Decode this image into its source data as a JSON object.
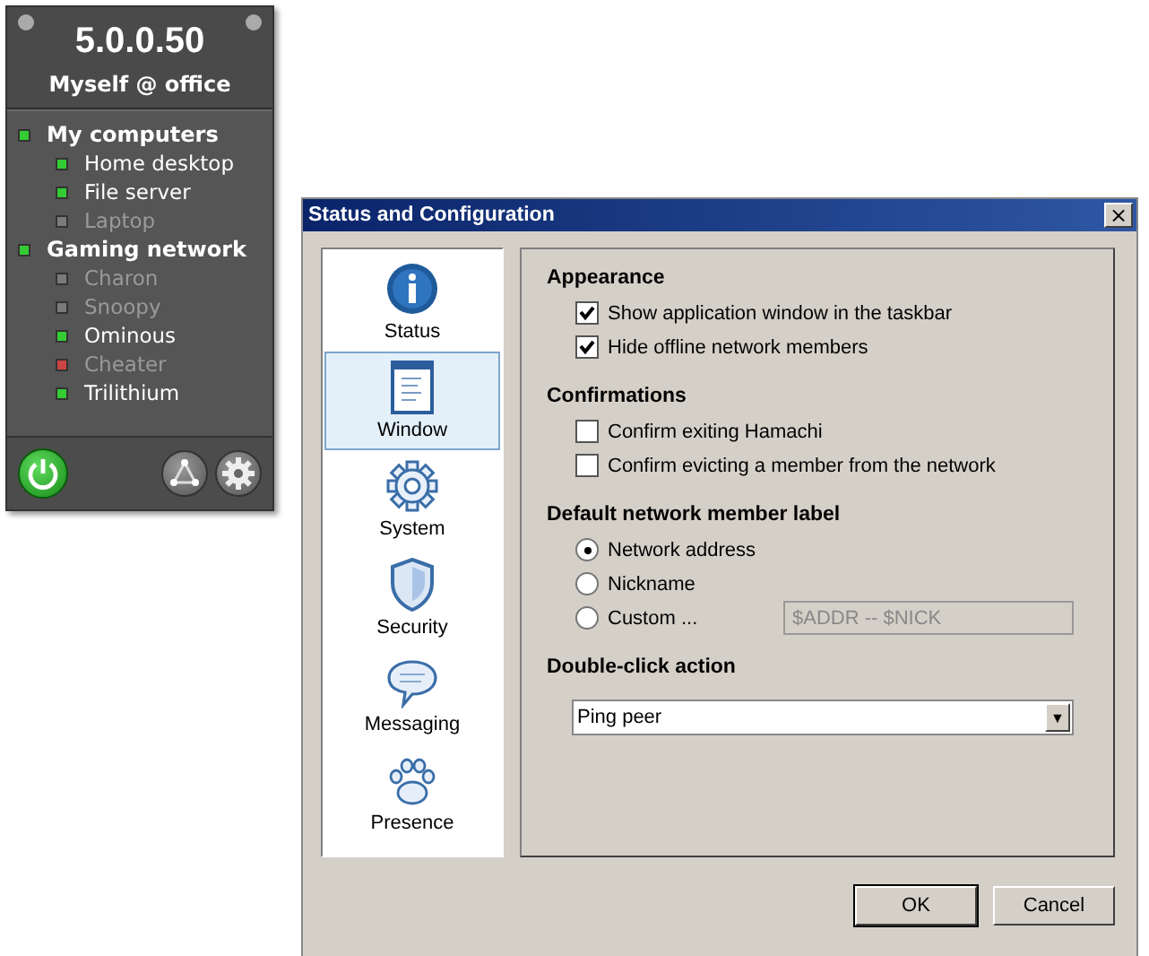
{
  "widget": {
    "version": "5.0.0.50",
    "user": "Myself @ office",
    "networks": [
      {
        "name": "My computers",
        "color": "#33cc33",
        "online": true,
        "children": [
          {
            "name": "Home desktop",
            "color": "#33cc33",
            "online": true
          },
          {
            "name": "File server",
            "color": "#33cc33",
            "online": true
          },
          {
            "name": "Laptop",
            "color": "#7a7a7a",
            "online": false
          }
        ]
      },
      {
        "name": "Gaming network",
        "color": "#33cc33",
        "online": true,
        "children": [
          {
            "name": "Charon",
            "color": "#7a7a7a",
            "online": false
          },
          {
            "name": "Snoopy",
            "color": "#7a7a7a",
            "online": false
          },
          {
            "name": "Ominous",
            "color": "#33cc33",
            "online": true
          },
          {
            "name": "Cheater",
            "color": "#cc4444",
            "online": false
          },
          {
            "name": "Trilithium",
            "color": "#33cc33",
            "online": true
          }
        ]
      }
    ]
  },
  "dialog": {
    "title": "Status and Configuration",
    "close": "×",
    "sidebar": [
      {
        "kind": "status",
        "label": "Status",
        "selected": false
      },
      {
        "kind": "window",
        "label": "Window",
        "selected": true
      },
      {
        "kind": "system",
        "label": "System",
        "selected": false
      },
      {
        "kind": "security",
        "label": "Security",
        "selected": false
      },
      {
        "kind": "messaging",
        "label": "Messaging",
        "selected": false
      },
      {
        "kind": "presence",
        "label": "Presence",
        "selected": false
      }
    ],
    "appearance": {
      "heading": "Appearance",
      "options": [
        {
          "label": "Show application window in the taskbar",
          "checked": true
        },
        {
          "label": "Hide offline network members",
          "checked": true
        }
      ]
    },
    "confirmations": {
      "heading": "Confirmations",
      "options": [
        {
          "label": "Confirm exiting Hamachi",
          "checked": false
        },
        {
          "label": "Confirm evicting a member from the network",
          "checked": false
        }
      ]
    },
    "member_label": {
      "heading": "Default network member label",
      "options": [
        {
          "label": "Network address",
          "selected": true
        },
        {
          "label": "Nickname",
          "selected": false
        },
        {
          "label": "Custom ...",
          "selected": false
        }
      ],
      "custom_field": {
        "value": "$ADDR -- $NICK",
        "disabled": true
      }
    },
    "double_click": {
      "heading": "Double-click action",
      "value": "Ping peer",
      "arrow": "▼"
    },
    "buttons": [
      "OK",
      "Cancel"
    ]
  }
}
